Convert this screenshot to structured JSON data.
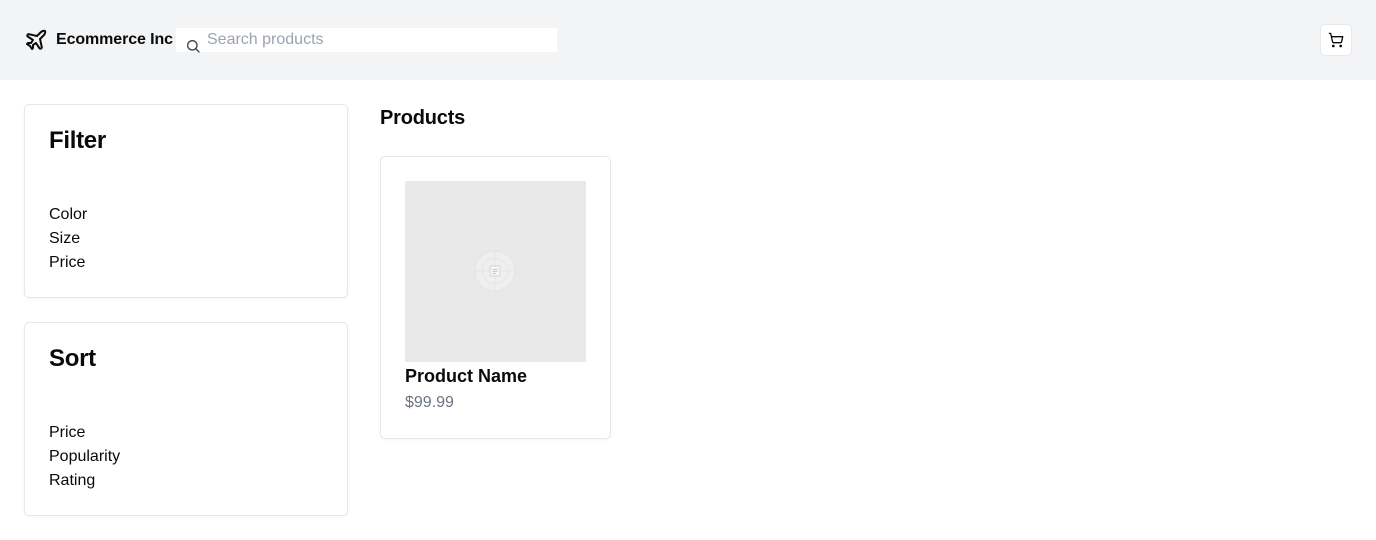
{
  "header": {
    "brand_name": "Ecommerce Inc",
    "brand_icon": "plane-icon",
    "search": {
      "placeholder": "Search products",
      "value": "",
      "icon": "search-icon"
    },
    "cart_icon": "shopping-cart-icon"
  },
  "filter": {
    "title": "Filter",
    "items": [
      "Color",
      "Size",
      "Price"
    ]
  },
  "sort": {
    "title": "Sort",
    "items": [
      "Price",
      "Popularity",
      "Rating"
    ]
  },
  "products": {
    "title": "Products",
    "items": [
      {
        "name": "Product Name",
        "price": "$99.99",
        "image_icon": "image-placeholder-icon"
      }
    ]
  },
  "colors": {
    "header_bg": "#f3f4f6",
    "border": "#e5e7eb",
    "muted_text": "#6b7280",
    "placeholder_text": "#9ca3af",
    "image_bg": "#e9e9e9"
  }
}
